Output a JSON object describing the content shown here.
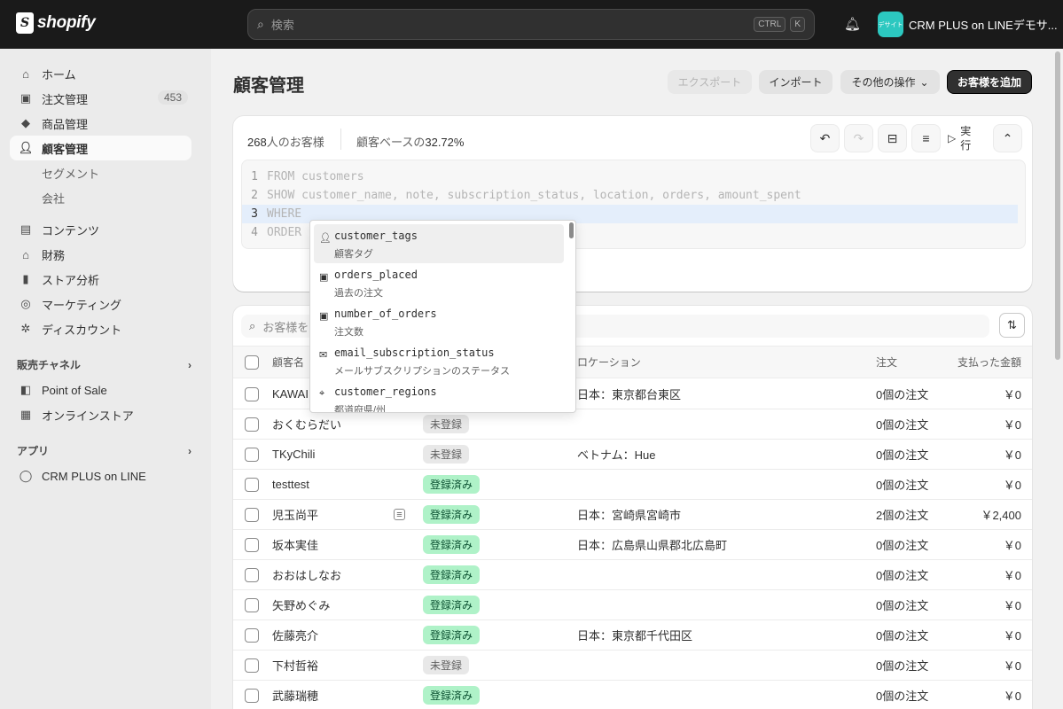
{
  "topbar": {
    "logo_text": "shopify",
    "search_placeholder": "検索",
    "shortcut": [
      "CTRL",
      "K"
    ],
    "store_name": "CRM PLUS on LINEデモサ...",
    "store_avatar_text": "デサイト"
  },
  "sidebar": {
    "items": [
      {
        "label": "ホーム",
        "icon": "home-icon"
      },
      {
        "label": "注文管理",
        "icon": "inbox-icon",
        "count": "453"
      },
      {
        "label": "商品管理",
        "icon": "tag-icon"
      },
      {
        "label": "顧客管理",
        "icon": "person-icon",
        "active": true
      },
      {
        "label": "セグメント"
      },
      {
        "label": "会社"
      },
      {
        "label": "コンテンツ",
        "icon": "content-icon"
      },
      {
        "label": "財務",
        "icon": "bank-icon"
      },
      {
        "label": "ストア分析",
        "icon": "chart-icon"
      },
      {
        "label": "マーケティング",
        "icon": "target-icon"
      },
      {
        "label": "ディスカウント",
        "icon": "discount-icon"
      }
    ],
    "channels_heading": "販売チャネル",
    "channels": [
      {
        "label": "Point of Sale",
        "icon": "pos-icon"
      },
      {
        "label": "オンラインストア",
        "icon": "store-icon"
      }
    ],
    "apps_heading": "アプリ",
    "apps": [
      {
        "label": "CRM PLUS on LINE",
        "icon": "chat-icon"
      }
    ]
  },
  "header": {
    "title": "顧客管理",
    "export_label": "エクスポート",
    "import_label": "インポート",
    "more_label": "その他の操作",
    "add_label": "お客様を追加"
  },
  "segment": {
    "count": "268",
    "count_suffix": "人のお客様",
    "base_label": "顧客ベースの",
    "base_pct": "32.72%",
    "run_label_1": "実",
    "run_label_2": "行",
    "code": [
      {
        "n": "1",
        "text": "FROM customers"
      },
      {
        "n": "2",
        "text": "SHOW customer_name, note, subscription_status, location, orders, amount_spent"
      },
      {
        "n": "3",
        "text": "WHERE"
      },
      {
        "n": "4",
        "text": "ORDER"
      }
    ]
  },
  "autocomplete": [
    {
      "name": "customer_tags",
      "desc": "顧客タグ",
      "icon": "person-icon"
    },
    {
      "name": "orders_placed",
      "desc": "過去の注文",
      "icon": "inbox-icon"
    },
    {
      "name": "number_of_orders",
      "desc": "注文数",
      "icon": "inbox-icon"
    },
    {
      "name": "email_subscription_status",
      "desc": "メールサブスクリプションのステータス",
      "icon": "mail-icon"
    },
    {
      "name": "customer_regions",
      "desc": "都道府県/州",
      "icon": "pin-icon"
    }
  ],
  "table": {
    "search_placeholder": "お客様を",
    "columns": {
      "name": "顧客名",
      "location": "ロケーション",
      "orders": "注文",
      "spent": "支払った金額"
    },
    "rows": [
      {
        "name": "KAWAI",
        "status": "",
        "location": "日本：東京都台東区",
        "orders": "0個の注文",
        "spent": "￥0"
      },
      {
        "name": "おくむらだい",
        "status": "未登録",
        "location": "",
        "orders": "0個の注文",
        "spent": "￥0"
      },
      {
        "name": "TKyChili",
        "status": "未登録",
        "location": "ベトナム：Hue",
        "orders": "0個の注文",
        "spent": "￥0"
      },
      {
        "name": "testtest",
        "status": "登録済み",
        "location": "",
        "orders": "0個の注文",
        "spent": "￥0"
      },
      {
        "name": "児玉尚平",
        "status": "登録済み",
        "location": "日本：宮崎県宮崎市",
        "orders": "2個の注文",
        "spent": "￥2,400",
        "note": true
      },
      {
        "name": "坂本実佳",
        "status": "登録済み",
        "location": "日本：広島県山県郡北広島町",
        "orders": "0個の注文",
        "spent": "￥0"
      },
      {
        "name": "おおはしなお",
        "status": "登録済み",
        "location": "",
        "orders": "0個の注文",
        "spent": "￥0"
      },
      {
        "name": "矢野めぐみ",
        "status": "登録済み",
        "location": "",
        "orders": "0個の注文",
        "spent": "￥0"
      },
      {
        "name": "佐藤亮介",
        "status": "登録済み",
        "location": "日本：東京都千代田区",
        "orders": "0個の注文",
        "spent": "￥0"
      },
      {
        "name": "下村哲裕",
        "status": "未登録",
        "location": "",
        "orders": "0個の注文",
        "spent": "￥0"
      },
      {
        "name": "武藤瑞穂",
        "status": "登録済み",
        "location": "",
        "orders": "0個の注文",
        "spent": "￥0"
      }
    ]
  },
  "colors": {
    "accent_green": "#aff2c8",
    "topbar": "#1a1a1a",
    "store_avatar": "#2cc8c0"
  }
}
